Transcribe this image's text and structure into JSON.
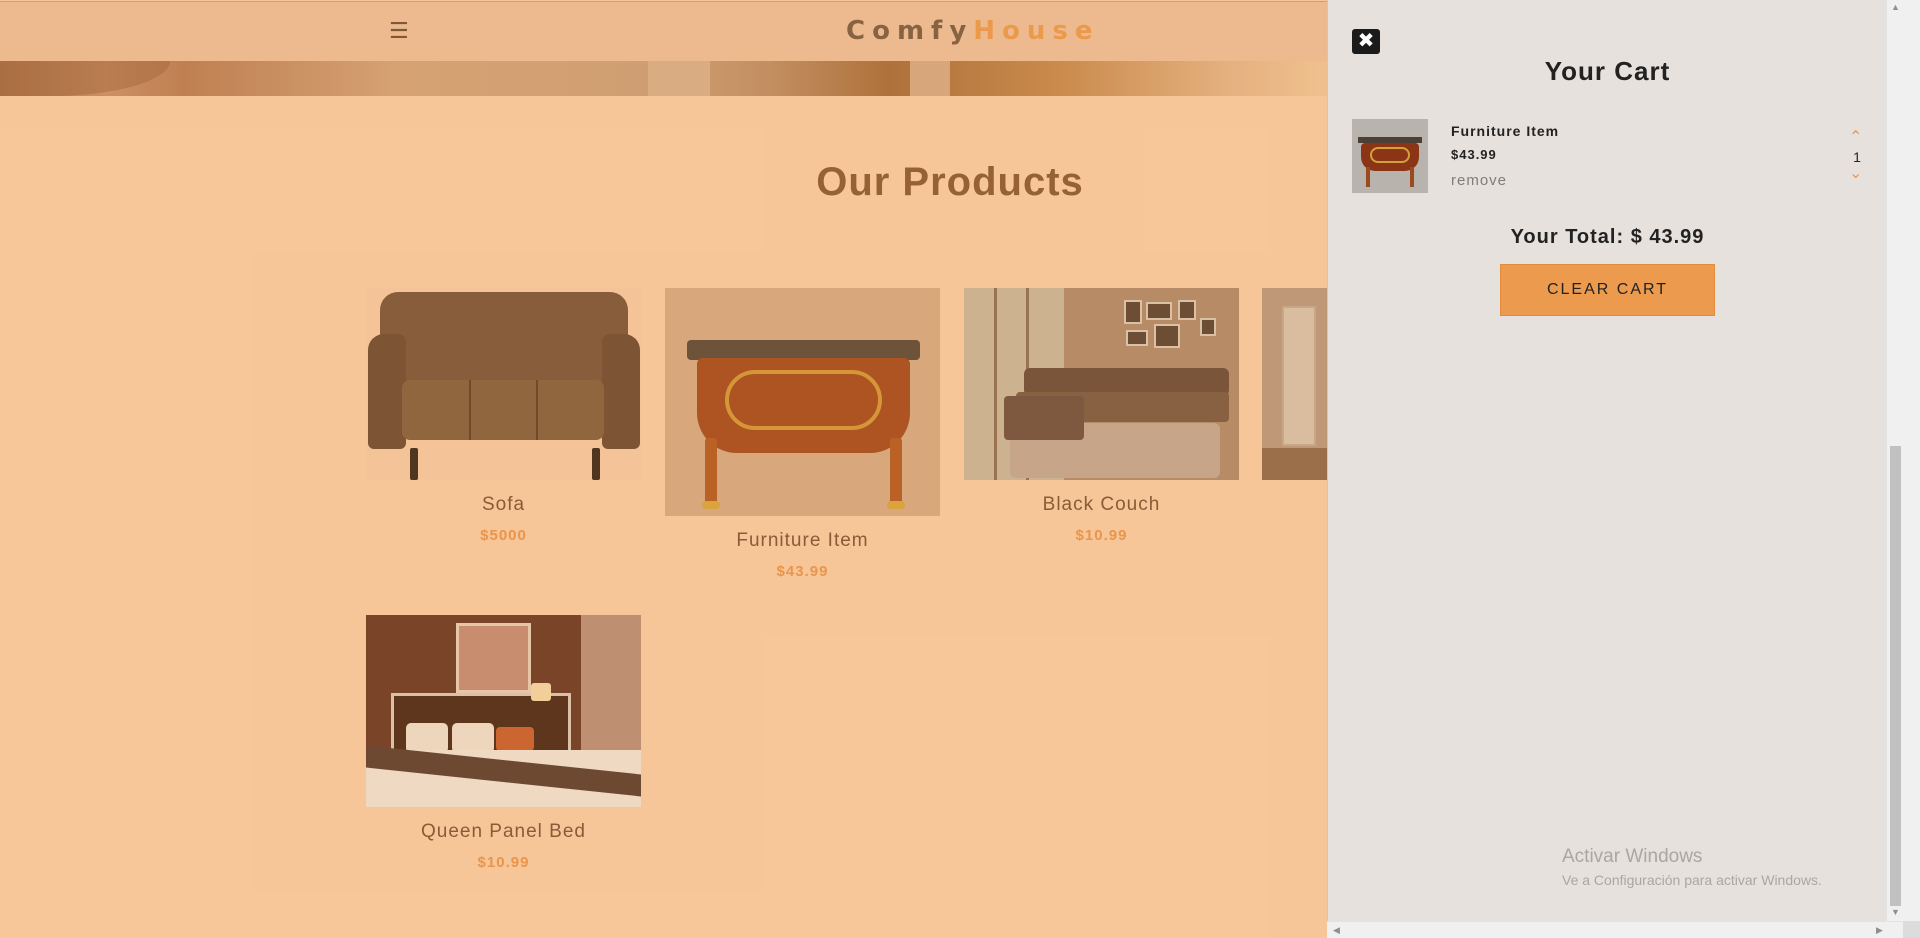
{
  "nav": {
    "menu_icon": "☰",
    "logo_part1": "Comfy",
    "logo_part2": "House"
  },
  "products_section": {
    "title": "Our Products",
    "items": [
      {
        "name": "Sofa",
        "price": "$5000"
      },
      {
        "name": "Furniture Item",
        "price": "$43.99"
      },
      {
        "name": "Black Couch",
        "price": "$10.99"
      },
      {
        "name": "Queen Panel Bed",
        "price": "$10.99"
      }
    ]
  },
  "cart": {
    "close_icon": "✖",
    "title": "Your Cart",
    "items": [
      {
        "name": "Furniture Item",
        "price": "$43.99",
        "remove_label": "remove",
        "quantity": "1"
      }
    ],
    "total_label": "Your Total: $ 43.99",
    "clear_label": "CLEAR CART"
  },
  "windows_activation": {
    "line1": "Activar Windows",
    "line2": "Ve a Configuración para activar Windows."
  },
  "colors": {
    "accent": "#eb9b4e",
    "page_bg": "#f8cda6",
    "cart_bg": "#e7e1dd"
  }
}
